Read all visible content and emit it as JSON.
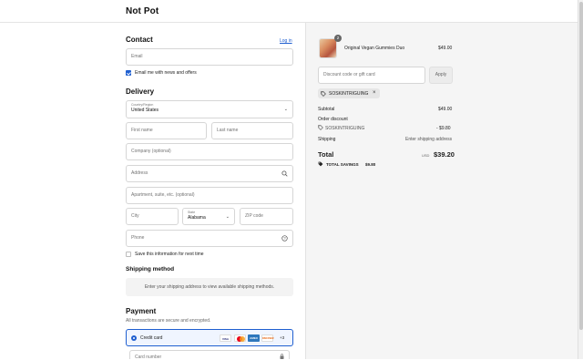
{
  "header": {
    "brand": "Not Pot"
  },
  "contact": {
    "title": "Contact",
    "login_link": "Log in",
    "email_placeholder": "Email",
    "news_label": "Email me with news and offers"
  },
  "delivery": {
    "title": "Delivery",
    "country_label": "Country/Region",
    "country_value": "United States",
    "first_name": "First name",
    "last_name": "Last name",
    "company": "Company (optional)",
    "address": "Address",
    "apartment": "Apartment, suite, etc. (optional)",
    "city": "City",
    "state_label": "State",
    "state_value": "Alabama",
    "zip": "ZIP code",
    "phone": "Phone",
    "save_label": "Save this information for next time"
  },
  "shipping": {
    "title": "Shipping method",
    "message": "Enter your shipping address to view available shipping methods."
  },
  "payment": {
    "title": "Payment",
    "subtitle": "All transactions are secure and encrypted.",
    "credit_card_label": "Credit card",
    "more_cards": "+3",
    "card_number": "Card number",
    "brands": [
      "VISA",
      "MC",
      "AMEX",
      "DISCOVER"
    ]
  },
  "summary": {
    "product_name": "Original Vegan Gummies Duo",
    "product_price": "$49.00",
    "quantity": "2",
    "discount_placeholder": "Discount code or gift card",
    "apply_label": "Apply",
    "code_tag": "SOSKINTRIGUING",
    "subtotal_label": "Subtotal",
    "subtotal_value": "$49.00",
    "order_discount_label": "Order discount",
    "discount_code": "SOSKINTRIGUING",
    "discount_value": "- $9.80",
    "shipping_label": "Shipping",
    "shipping_value": "Enter shipping address",
    "total_label": "Total",
    "currency": "USD",
    "total_value": "$39.20",
    "savings_label": "TOTAL SAVINGS",
    "savings_value": "$9.80"
  },
  "colors": {
    "accent": "#1f5fd0",
    "pane": "#f5f5f5"
  }
}
